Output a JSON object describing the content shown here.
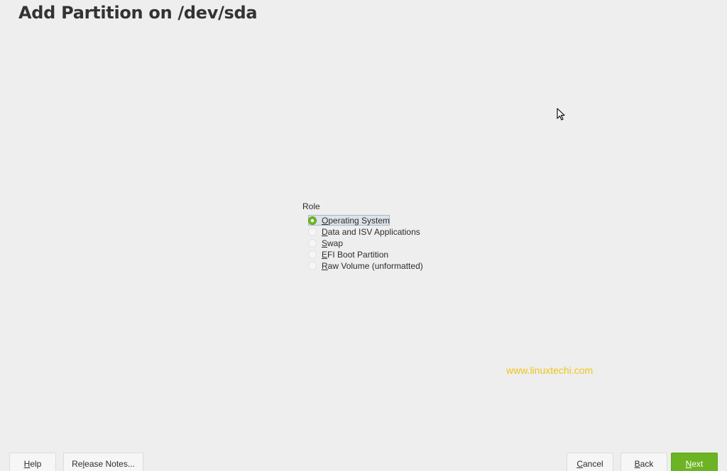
{
  "page": {
    "title": "Add Partition on /dev/sda"
  },
  "role": {
    "label": "Role",
    "selected": "Operating System",
    "options": [
      {
        "mnemonic": "O",
        "rest": "perating System",
        "label": "Operating System",
        "checked": true
      },
      {
        "mnemonic": "D",
        "rest": "ata and ISV Applications",
        "label": "Data and ISV Applications",
        "checked": false
      },
      {
        "mnemonic": "S",
        "rest": "wap",
        "label": "Swap",
        "checked": false
      },
      {
        "mnemonic": "E",
        "rest": "FI Boot Partition",
        "label": "EFI Boot Partition",
        "checked": false
      },
      {
        "mnemonic": "R",
        "rest": "aw Volume (unformatted)",
        "label": "Raw Volume (unformatted)",
        "checked": false
      }
    ]
  },
  "watermark": "www.linuxtechi.com",
  "buttons": {
    "help": {
      "mnemonic": "H",
      "rest": "elp"
    },
    "release_notes": {
      "pre": "Re",
      "mnemonic": "l",
      "rest": "ease Notes..."
    },
    "cancel": {
      "mnemonic": "C",
      "rest": "ancel"
    },
    "back": {
      "mnemonic": "B",
      "rest": "ack"
    },
    "next": {
      "mnemonic": "N",
      "rest": "ext"
    }
  },
  "colors": {
    "accent": "#6cb423",
    "watermark": "#f0c419",
    "background": "#eeeeee"
  }
}
